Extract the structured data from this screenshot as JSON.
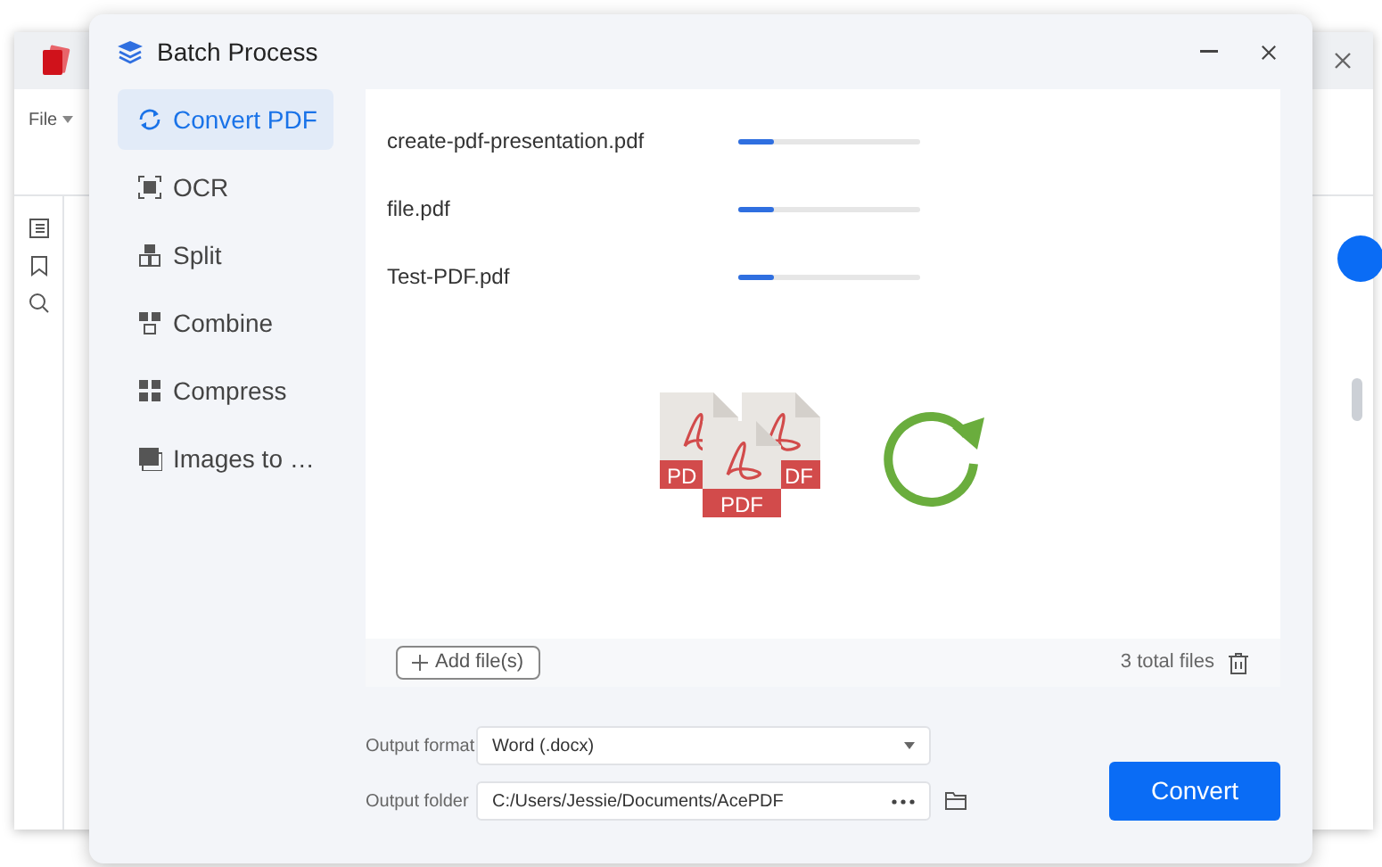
{
  "app_window": {
    "menu": "File"
  },
  "dialog": {
    "title": "Batch Process",
    "sidebar": [
      {
        "label": "Convert PDF",
        "kind": "convert",
        "selected": true
      },
      {
        "label": "OCR",
        "kind": "ocr",
        "selected": false
      },
      {
        "label": "Split",
        "kind": "split",
        "selected": false
      },
      {
        "label": "Combine",
        "kind": "combine",
        "selected": false
      },
      {
        "label": "Compress",
        "kind": "compress",
        "selected": false
      },
      {
        "label": "Images to …",
        "kind": "images",
        "selected": false
      }
    ],
    "files": [
      {
        "name": "create-pdf-presentation.pdf",
        "level": 0.2
      },
      {
        "name": "file.pdf",
        "level": 0.2
      },
      {
        "name": "Test-PDF.pdf",
        "level": 0.2
      }
    ],
    "illustration_labels": [
      "PD",
      "DF",
      "PDF"
    ],
    "add_button": "Add file(s)",
    "total": "3 total files",
    "output_format": {
      "label": "Output format",
      "value": "Word (.docx)"
    },
    "output_folder": {
      "label": "Output folder",
      "value": "C:/Users/Jessie/Documents/AcePDF"
    },
    "convert_button": "Convert"
  }
}
